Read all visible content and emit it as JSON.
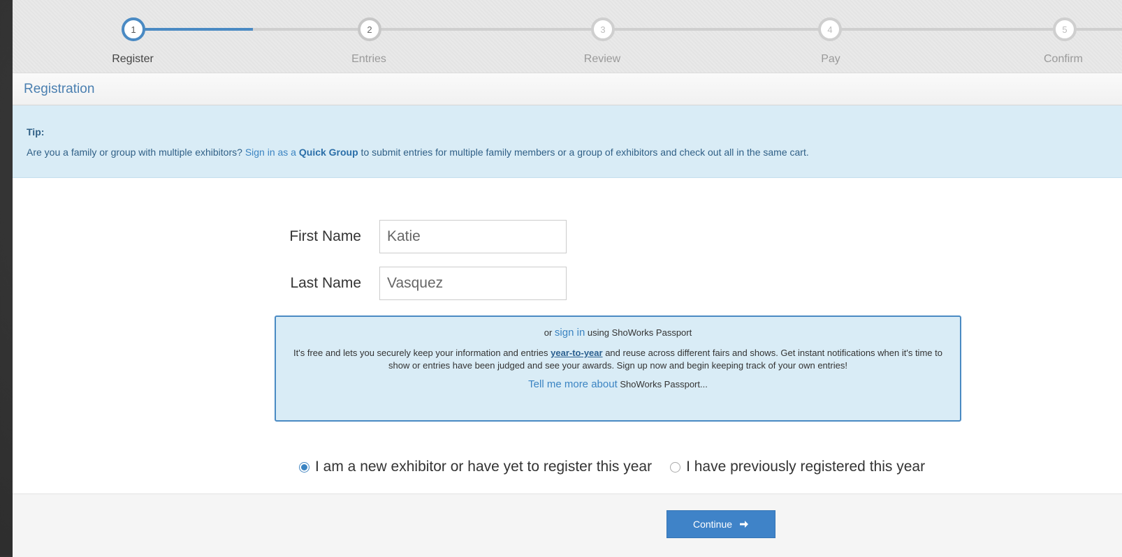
{
  "stepper": {
    "steps": [
      {
        "number": "1",
        "label": "Register",
        "state": "active"
      },
      {
        "number": "2",
        "label": "Entries",
        "state": "upcoming"
      },
      {
        "number": "3",
        "label": "Review",
        "state": "upcoming"
      },
      {
        "number": "4",
        "label": "Pay",
        "state": "upcoming"
      },
      {
        "number": "5",
        "label": "Confirm",
        "state": "upcoming"
      }
    ]
  },
  "panel": {
    "title": "Registration"
  },
  "tip": {
    "title": "Tip:",
    "text_before": "Are you a family or group with multiple exhibitors? ",
    "link_text": "Sign in as a ",
    "link_strong": "Quick Group",
    "text_after": " to submit entries for multiple family members or a group of exhibitors and check out all in the same cart."
  },
  "form": {
    "first_name_label": "First Name",
    "first_name_value": "Katie",
    "last_name_label": "Last Name",
    "last_name_value": "Vasquez"
  },
  "passport": {
    "line1_before": "or ",
    "line1_link": "sign in",
    "line1_after": " using ShoWorks Passport",
    "body_before": "It's free and lets you securely keep your information and entries ",
    "body_emphasis": "year-to-year",
    "body_after": " and reuse across different fairs and shows. Get instant notifications when it's time to show or entries have been judged and see your awards. Sign up now and begin keeping track of your own entries!",
    "more_link": "Tell me more about",
    "more_after": " ShoWorks Passport..."
  },
  "exhibitor_status": {
    "option_new": "I am a new exhibitor or have yet to register this year",
    "option_previous": "I have previously registered this year",
    "selected": "new"
  },
  "actions": {
    "continue_label": "Continue"
  },
  "colors": {
    "accent": "#3f83c8",
    "tip_bg": "#d9ecf6"
  }
}
